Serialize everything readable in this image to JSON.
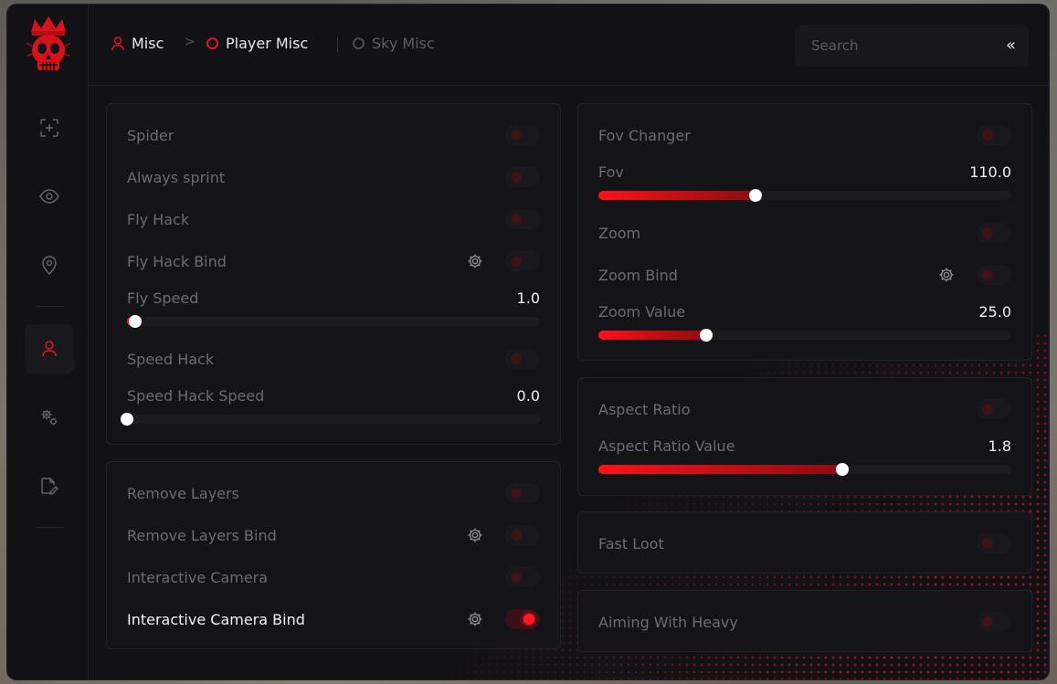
{
  "breadcrumb": {
    "items": [
      {
        "label": "Misc"
      },
      {
        "label": "Player Misc"
      },
      {
        "label": "Sky Misc"
      }
    ],
    "separator": ">"
  },
  "search": {
    "placeholder": "Search",
    "collapse_icon": "«"
  },
  "sidebar": {
    "icons": [
      "crosshair-icon",
      "eye-icon",
      "location-pin-icon",
      "user-icon",
      "gears-icon",
      "edit-file-icon"
    ],
    "active": "user-icon"
  },
  "colors": {
    "accent": "#ff1a1f",
    "background": "#121216",
    "panel": "#141418"
  },
  "left_panel_1": {
    "spider": {
      "label": "Spider",
      "enabled": false
    },
    "always_sprint": {
      "label": "Always sprint",
      "enabled": false
    },
    "fly_hack": {
      "label": "Fly Hack",
      "enabled": false
    },
    "fly_hack_bind": {
      "label": "Fly Hack Bind",
      "enabled": false
    },
    "fly_speed": {
      "label": "Fly Speed",
      "value": "1.0",
      "fraction": 0.02
    },
    "speed_hack": {
      "label": "Speed Hack",
      "enabled": false
    },
    "speed_hack_speed": {
      "label": "Speed Hack Speed",
      "value": "0.0",
      "fraction": 0.0
    }
  },
  "left_panel_2": {
    "remove_layers": {
      "label": "Remove Layers",
      "enabled": false
    },
    "remove_layers_bind": {
      "label": "Remove Layers Bind",
      "enabled": false
    },
    "interactive_camera": {
      "label": "Interactive Camera",
      "enabled": false
    },
    "interactive_camera_bind": {
      "label": "Interactive Camera Bind",
      "enabled": true
    }
  },
  "right_panel_1": {
    "fov_changer": {
      "label": "Fov Changer",
      "enabled": false
    },
    "fov": {
      "label": "Fov",
      "value": "110.0",
      "fraction": 0.38
    },
    "zoom": {
      "label": "Zoom",
      "enabled": false
    },
    "zoom_bind": {
      "label": "Zoom Bind",
      "enabled": false
    },
    "zoom_value": {
      "label": "Zoom Value",
      "value": "25.0",
      "fraction": 0.26
    }
  },
  "right_panel_2": {
    "aspect_ratio": {
      "label": "Aspect Ratio",
      "enabled": false
    },
    "aspect_ratio_value": {
      "label": "Aspect Ratio Value",
      "value": "1.8",
      "fraction": 0.59
    }
  },
  "right_panel_3": {
    "fast_loot": {
      "label": "Fast Loot",
      "enabled": false
    }
  },
  "right_panel_4": {
    "aiming_with_heavy": {
      "label": "Aiming With Heavy",
      "enabled": false
    }
  }
}
